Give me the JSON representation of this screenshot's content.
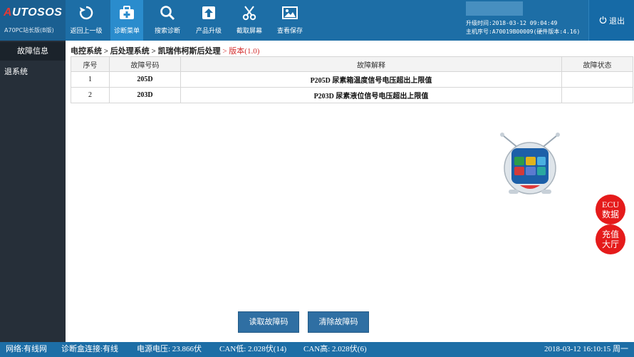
{
  "logo": {
    "brand_prefix": "A",
    "brand_rest": "UTOSOS",
    "edition": "A70PC站长版(B版)"
  },
  "toolbar": [
    {
      "label": "返回上一级",
      "icon": "back-icon"
    },
    {
      "label": "诊断菜单",
      "icon": "medical-kit-icon",
      "active": true
    },
    {
      "label": "搜索诊断",
      "icon": "search-icon"
    },
    {
      "label": "产品升级",
      "icon": "upload-icon"
    },
    {
      "label": "截取屏幕",
      "icon": "scissors-icon"
    },
    {
      "label": "查看保存",
      "icon": "image-icon"
    }
  ],
  "device_info": {
    "upgrade_time": "升级时间:2018-03-12 09:04:49",
    "host_serial": "主机序号:A70019B00009(硬件版本:4.16)"
  },
  "exit_label": "退出",
  "sidebar": [
    {
      "label": "故障信息",
      "active": true
    },
    {
      "label": "退系统"
    }
  ],
  "breadcrumb": {
    "items": [
      "电控系统",
      "后处理系统",
      "凯瑞伟柯斯后处理"
    ],
    "separator": ">",
    "current": "版本(1.0)"
  },
  "table": {
    "headers": [
      "序号",
      "故障号码",
      "故障解释",
      "故障状态"
    ],
    "rows": [
      {
        "no": "1",
        "code": "205D",
        "desc": "P205D 尿素箱温度信号电压超出上限值",
        "status": ""
      },
      {
        "no": "2",
        "code": "203D",
        "desc": "P203D 尿素液位信号电压超出上限值",
        "status": ""
      }
    ]
  },
  "float_buttons": {
    "ecu_line1": "ECU",
    "ecu_line2": "数据",
    "recharge_line1": "充值",
    "recharge_line2": "大厅"
  },
  "actions": {
    "read": "读取故障码",
    "clear": "清除故障码"
  },
  "status_bar": {
    "network": "网络:有线网",
    "box_connection": "诊断盒连接:有线",
    "voltage": "电源电压: 23.866伏",
    "can_low": "CAN低: 2.028伏(14)",
    "can_high": "CAN高: 2.028伏(6)",
    "datetime": "2018-03-12 16:10:15 周一"
  },
  "colors": {
    "header_blue": "#1d6ea6",
    "active_tool": "#2a8ccd",
    "sidebar": "#262f39",
    "accent_red": "#e51b1b",
    "breadcrumb_current": "#d32f2f"
  }
}
